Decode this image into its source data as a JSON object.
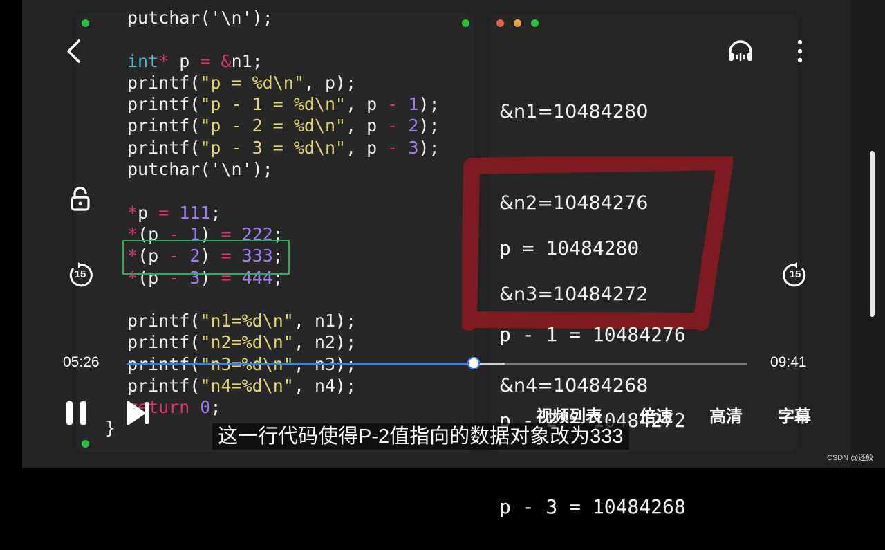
{
  "code": {
    "lines": [
      [
        {
          "t": "putchar('\\n');",
          "c": ""
        }
      ],
      [],
      [
        {
          "t": "int",
          "c": "kw"
        },
        {
          "t": "*",
          "c": "op"
        },
        {
          "t": " p ",
          "c": ""
        },
        {
          "t": "=",
          "c": "op"
        },
        {
          "t": " ",
          "c": ""
        },
        {
          "t": "&",
          "c": "op"
        },
        {
          "t": "n1;",
          "c": ""
        }
      ],
      [
        {
          "t": "printf(",
          "c": ""
        },
        {
          "t": "\"p = %d\\n\"",
          "c": "str"
        },
        {
          "t": ", p);",
          "c": ""
        }
      ],
      [
        {
          "t": "printf(",
          "c": ""
        },
        {
          "t": "\"p - 1 = %d\\n\"",
          "c": "str"
        },
        {
          "t": ", p ",
          "c": ""
        },
        {
          "t": "-",
          "c": "op"
        },
        {
          "t": " ",
          "c": ""
        },
        {
          "t": "1",
          "c": "num"
        },
        {
          "t": ");",
          "c": ""
        }
      ],
      [
        {
          "t": "printf(",
          "c": ""
        },
        {
          "t": "\"p - 2 = %d\\n\"",
          "c": "str"
        },
        {
          "t": ", p ",
          "c": ""
        },
        {
          "t": "-",
          "c": "op"
        },
        {
          "t": " ",
          "c": ""
        },
        {
          "t": "2",
          "c": "num"
        },
        {
          "t": ");",
          "c": ""
        }
      ],
      [
        {
          "t": "printf(",
          "c": ""
        },
        {
          "t": "\"p - 3 = %d\\n\"",
          "c": "str"
        },
        {
          "t": ", p ",
          "c": ""
        },
        {
          "t": "-",
          "c": "op"
        },
        {
          "t": " ",
          "c": ""
        },
        {
          "t": "3",
          "c": "num"
        },
        {
          "t": ");",
          "c": ""
        }
      ],
      [
        {
          "t": "putchar('\\n');",
          "c": ""
        }
      ],
      [],
      [
        {
          "t": "*",
          "c": "op"
        },
        {
          "t": "p ",
          "c": ""
        },
        {
          "t": "=",
          "c": "op"
        },
        {
          "t": " ",
          "c": ""
        },
        {
          "t": "111",
          "c": "num"
        },
        {
          "t": ";",
          "c": ""
        }
      ],
      [
        {
          "t": "*",
          "c": "op"
        },
        {
          "t": "(p ",
          "c": ""
        },
        {
          "t": "-",
          "c": "op"
        },
        {
          "t": " ",
          "c": ""
        },
        {
          "t": "1",
          "c": "num"
        },
        {
          "t": ") ",
          "c": ""
        },
        {
          "t": "=",
          "c": "op"
        },
        {
          "t": " ",
          "c": ""
        },
        {
          "t": "222",
          "c": "num"
        },
        {
          "t": ";",
          "c": ""
        }
      ],
      [
        {
          "t": "*",
          "c": "op"
        },
        {
          "t": "(p ",
          "c": ""
        },
        {
          "t": "-",
          "c": "op"
        },
        {
          "t": " ",
          "c": ""
        },
        {
          "t": "2",
          "c": "num"
        },
        {
          "t": ") ",
          "c": ""
        },
        {
          "t": "=",
          "c": "op"
        },
        {
          "t": " ",
          "c": ""
        },
        {
          "t": "333",
          "c": "num"
        },
        {
          "t": ";",
          "c": ""
        }
      ],
      [
        {
          "t": "*",
          "c": "op"
        },
        {
          "t": "(p ",
          "c": ""
        },
        {
          "t": "-",
          "c": "op"
        },
        {
          "t": " ",
          "c": ""
        },
        {
          "t": "3",
          "c": "num"
        },
        {
          "t": ") ",
          "c": ""
        },
        {
          "t": "=",
          "c": "op"
        },
        {
          "t": " ",
          "c": ""
        },
        {
          "t": "444",
          "c": "num"
        },
        {
          "t": ";",
          "c": ""
        }
      ],
      [],
      [
        {
          "t": "printf(",
          "c": ""
        },
        {
          "t": "\"n1=%d\\n\"",
          "c": "str"
        },
        {
          "t": ", n1);",
          "c": ""
        }
      ],
      [
        {
          "t": "printf(",
          "c": ""
        },
        {
          "t": "\"n2=%d\\n\"",
          "c": "str"
        },
        {
          "t": ", n2);",
          "c": ""
        }
      ],
      [
        {
          "t": "printf(",
          "c": ""
        },
        {
          "t": "\"n3=%d\\n\"",
          "c": "str"
        },
        {
          "t": ", n3);",
          "c": ""
        }
      ],
      [
        {
          "t": "printf(",
          "c": ""
        },
        {
          "t": "\"n4=%d\\n\"",
          "c": "str"
        },
        {
          "t": ", n4);",
          "c": ""
        }
      ],
      [
        {
          "t": "return",
          "c": "op"
        },
        {
          "t": " ",
          "c": ""
        },
        {
          "t": "0",
          "c": "num"
        },
        {
          "t": ";",
          "c": ""
        }
      ]
    ],
    "closing_brace": "}"
  },
  "output": {
    "addresses": [
      "&n1=10484280",
      "&n2=10484276",
      "&n3=10484272",
      "&n4=10484268"
    ],
    "pointers": [
      "p = 10484280",
      "p - 1 = 10484276",
      "p - 2 = 10484272",
      "p - 3 = 10484268"
    ]
  },
  "player": {
    "current_time": "05:26",
    "total_time": "09:41",
    "progress": 0.56,
    "buffered": 0.61,
    "skip_back_seconds": "15",
    "skip_forward_seconds": "15",
    "menu": [
      "视频列表",
      "倍速",
      "高清",
      "字幕"
    ],
    "subtitle": "这一行代码使得P-2值指向的数据对象改为333"
  },
  "colors": {
    "accent": "#2f7fff",
    "highlight_box": "#23b04e",
    "annotation_red": "#8e1a22"
  },
  "icons": [
    "back-icon",
    "headphones-icon",
    "more-icon",
    "lock-icon",
    "replay-15-icon",
    "forward-15-icon",
    "pause-icon",
    "next-icon"
  ],
  "watermark": "CSDN @还鲛"
}
